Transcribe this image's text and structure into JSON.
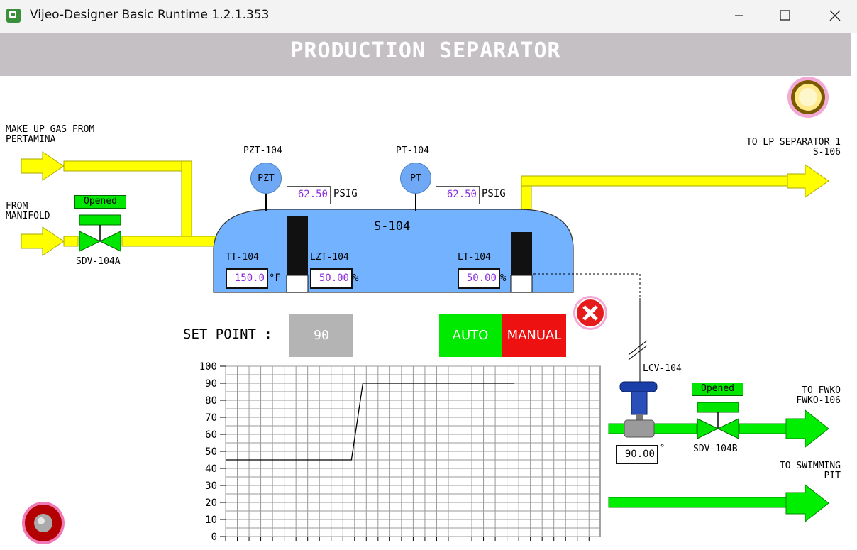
{
  "window": {
    "title": "Vijeo-Designer Basic Runtime 1.2.1.353"
  },
  "header": {
    "title": "PRODUCTION SEPARATOR"
  },
  "inlets": {
    "makeup_gas": "MAKE UP GAS FROM\nPERTAMINA",
    "manifold": "FROM\nMANIFOLD"
  },
  "outlets": {
    "lp_separator": "TO LP SEPARATOR 1\nS-106",
    "fwko": "TO FWKO\nFWKO-106",
    "swimming_pit": "TO SWIMMING\nPIT"
  },
  "vessel": {
    "tag": "S-104"
  },
  "instruments": {
    "pzt": {
      "tag": "PZT-104",
      "symbol": "PZT",
      "value": "62.50",
      "unit": "PSIG"
    },
    "pt": {
      "tag": "PT-104",
      "symbol": "PT",
      "value": "62.50",
      "unit": "PSIG"
    },
    "tt": {
      "tag": "TT-104",
      "value": "150.0",
      "unit": "°F"
    },
    "lzt": {
      "tag": "LZT-104",
      "value": "50.00",
      "unit": "%"
    },
    "lt": {
      "tag": "LT-104",
      "value": "50.00",
      "unit": "%"
    }
  },
  "valves": {
    "sdv_a": {
      "tag": "SDV-104A",
      "status": "Opened"
    },
    "sdv_b": {
      "tag": "SDV-104B",
      "status": "Opened"
    },
    "lcv": {
      "tag": "LCV-104",
      "position": "90.00",
      "unit": "°"
    }
  },
  "controller": {
    "setpoint_label": "SET POINT :",
    "setpoint_value": "90",
    "auto_label": "AUTO",
    "manual_label": "MANUAL"
  },
  "colors": {
    "gas_line": "#ffff00",
    "liquid_line": "#00ee00",
    "vessel": "#73b2ff",
    "auto": "#00ea00",
    "manual": "#ee1111"
  },
  "chart_data": {
    "type": "line",
    "ylim": [
      0,
      100
    ],
    "yticks": [
      "100",
      "90",
      "80",
      "70",
      "60",
      "50",
      "40",
      "30",
      "20",
      "10",
      "0"
    ],
    "series": [
      {
        "values": [
          [
            0,
            45
          ],
          [
            44,
            45
          ],
          [
            48,
            90
          ],
          [
            101,
            90
          ]
        ]
      }
    ],
    "xlim": [
      0,
      131
    ],
    "grid": true
  }
}
